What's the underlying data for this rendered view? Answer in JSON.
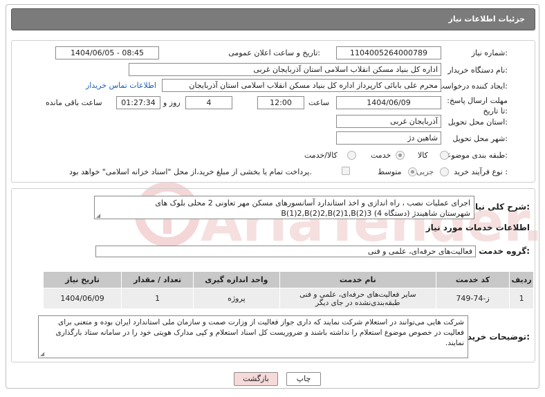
{
  "window": {
    "title": "جزئیات اطلاعات نیاز"
  },
  "watermark": {
    "text": "AriaTender.net"
  },
  "fields": {
    "need_number": {
      "label": "شماره نیاز:",
      "value": "1104005264000789"
    },
    "announce_datetime": {
      "label": "تاریخ و ساعت اعلان عمومی:",
      "value": "1404/06/05 - 08:45"
    },
    "buyer_org": {
      "label": "نام دستگاه خریدار:",
      "value": "اداره کل بنیاد مسکن انقلاب اسلامی استان آذربایجان غربی"
    },
    "requester": {
      "label": "ایجاد کننده درخواست:",
      "value": "محرم علی بابائی کارپرداز اداره کل بنیاد مسکن انقلاب اسلامی استان آذربایجان",
      "contact_link": "اطلاعات تماس خریدار"
    },
    "deadline": {
      "label": "مهلت ارسال پاسخ: تا تاریخ:",
      "date": "1404/06/09",
      "time_label": "ساعت",
      "time": "12:00",
      "days": "4",
      "days_label": "روز و",
      "remaining": "01:27:34",
      "remaining_label": "ساعت باقی مانده"
    },
    "province": {
      "label": "استان محل تحویل:",
      "value": "آذربایجان غربی"
    },
    "city": {
      "label": "شهر محل تحویل:",
      "value": "شاهین دژ"
    },
    "category": {
      "label": "طبقه بندی موضوعی:",
      "options": [
        "کالا",
        "خدمت",
        "کالا/خدمت"
      ],
      "selected": "خدمت"
    },
    "purchase_type": {
      "label": "نوع فرآیند خرید :",
      "options": [
        "جزیی",
        "متوسط"
      ],
      "selected": "متوسط",
      "note": "پرداخت تمام یا بخشی از مبلغ خرید،از محل \"اسناد خزانه اسلامی\" خواهد بود."
    }
  },
  "description": {
    "label": "شرح کلی نیاز:",
    "value": "اجرای عملیات نصب ، راه اندازی و اخذ استاندارد آسانسورهای مسکن مهر تعاونی 2  محلی بلوک های B(1)2,B(2)2,B(2)1,B(2)3 (4 دستگاه) شهرستان شاهیندژ"
  },
  "services_section": {
    "title": "اطلاعات خدمات مورد نیاز",
    "group_label": "گروه خدمت:",
    "group_value": "فعالیت‌های حرفه‌ای، علمی و فنی",
    "table": {
      "headers": [
        "ردیف",
        "کد خدمت",
        "نام خدمت",
        "واحد اندازه گیری",
        "تعداد / مقدار",
        "تاریخ نیاز"
      ],
      "rows": [
        [
          "1",
          "ز-74-749",
          "سایر فعالیت‌های حرفه‌ای، علمی و فنی طبقه‌بندی‌نشده در جای دیگر",
          "پروژه",
          "1",
          "1404/06/09"
        ]
      ]
    }
  },
  "buyer_notes": {
    "label": "توضیحات خریدار:",
    "value": "شرکت هایی می‌توانند در استعلام شرکت نمایند که داری جواز فعالیت از وزارت صمت و سازمان ملی استاندارد ایران بوده و متعنی برای فعالیت در خصوص موضوع استعلام را نداشته باشند و ضروریست کل اسناد استعلام و کپی مدارک هویتی خود را در سامانه ستاد بارگذاری نمایند."
  },
  "buttons": {
    "print": "چاپ",
    "back": "بازگشت"
  },
  "colors": {
    "title_bar": "#7b7b7b",
    "link": "#1a5fb4",
    "back_button": "#f6d9d9",
    "table_header": "#c8c8c8"
  }
}
